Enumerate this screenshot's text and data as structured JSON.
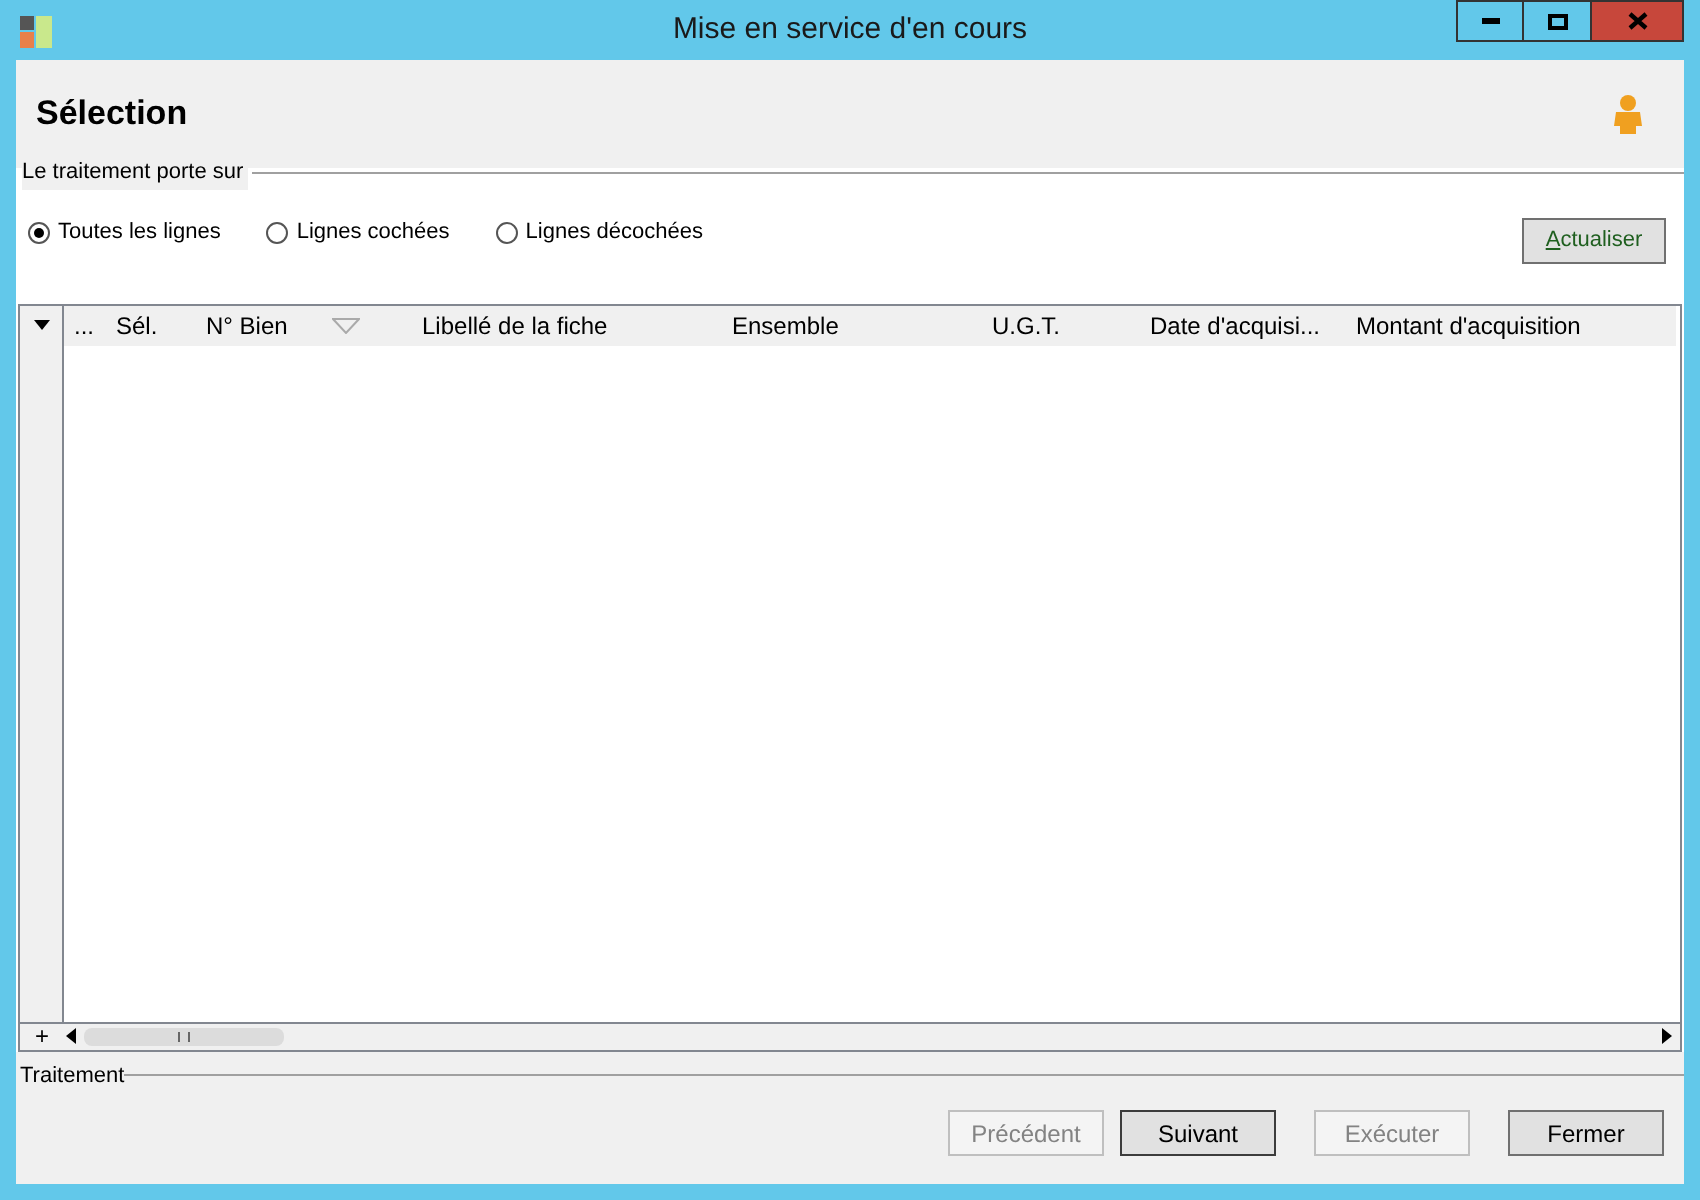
{
  "window": {
    "title": "Mise en service d'en cours"
  },
  "header": {
    "title": "Sélection"
  },
  "scope": {
    "label": "Le traitement porte sur",
    "options": [
      {
        "label": "Toutes les lignes",
        "selected": true
      },
      {
        "label": "Lignes cochées",
        "selected": false
      },
      {
        "label": "Lignes décochées",
        "selected": false
      }
    ],
    "refresh_button": "Actualiser"
  },
  "table": {
    "expand_symbol": "+",
    "columns": [
      {
        "label": "...",
        "sortable": false
      },
      {
        "label": "Sél.",
        "sortable": false
      },
      {
        "label": "N° Bien",
        "sortable": true
      },
      {
        "label": "Libellé de la fiche",
        "sortable": false
      },
      {
        "label": "Ensemble",
        "sortable": false
      },
      {
        "label": "U.G.T.",
        "sortable": false
      },
      {
        "label": "Date d'acquisi...",
        "sortable": false
      },
      {
        "label": "Montant d'acquisition",
        "sortable": false
      }
    ]
  },
  "footer": {
    "label": "Traitement",
    "buttons": [
      {
        "label": "Précédent",
        "disabled": true,
        "focused": false
      },
      {
        "label": "Suivant",
        "disabled": false,
        "focused": true
      },
      {
        "label": "Exécuter",
        "disabled": true,
        "focused": false
      },
      {
        "label": "Fermer",
        "disabled": false,
        "focused": false
      }
    ]
  }
}
